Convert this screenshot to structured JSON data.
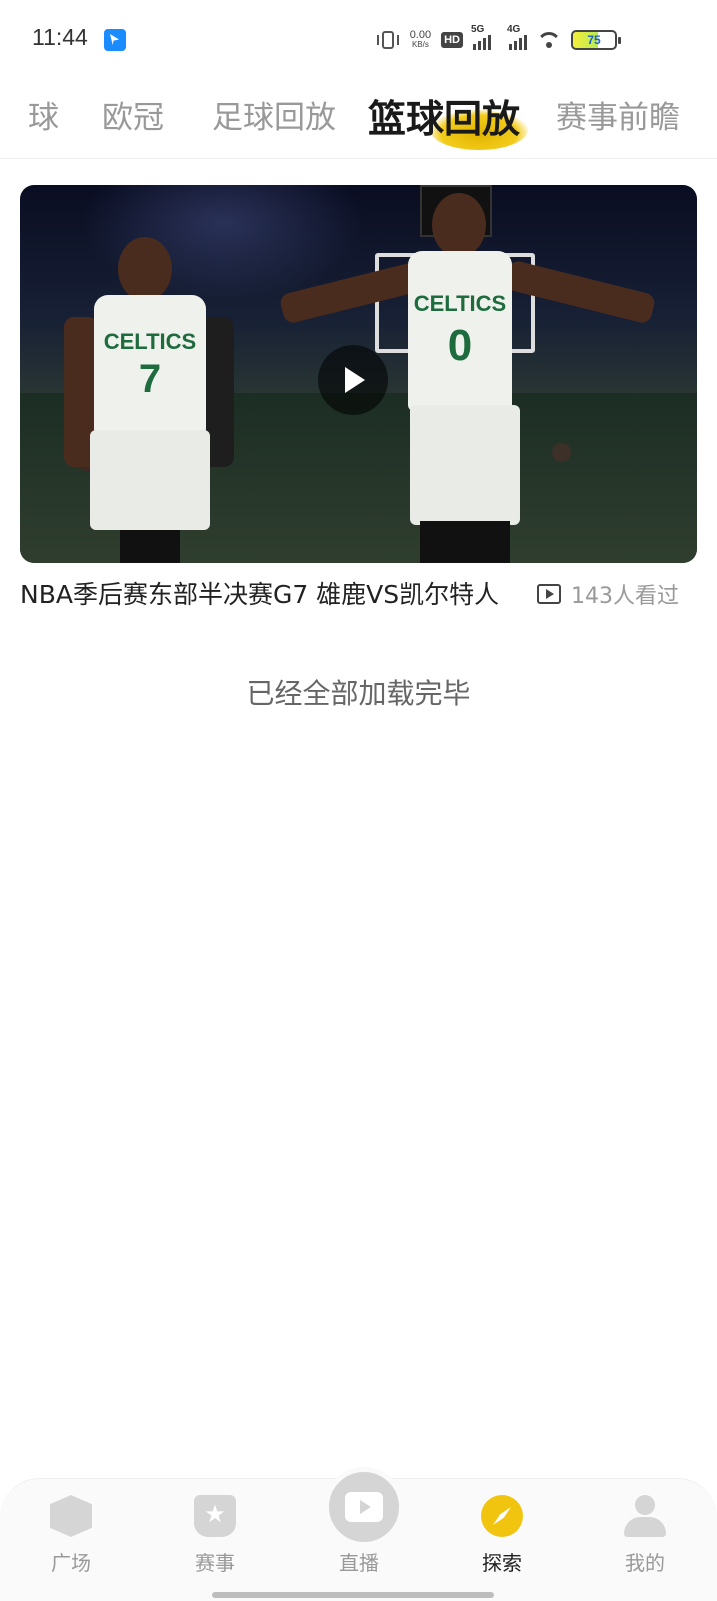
{
  "status_bar": {
    "time": "11:44",
    "net_speed_value": "0.00",
    "net_speed_unit": "KB/s",
    "hd_label": "HD",
    "signal1_label": "5G",
    "signal2_label": "4G",
    "battery_level": "75"
  },
  "tabs": [
    {
      "label": "球",
      "active": false
    },
    {
      "label": "欧冠",
      "active": false
    },
    {
      "label": "足球回放",
      "active": false
    },
    {
      "label": "篮球回放",
      "active": true
    },
    {
      "label": "赛事前瞻",
      "active": false
    }
  ],
  "video": {
    "title": "NBA季后赛东部半决赛G7 雄鹿VS凯尔特人",
    "views": "143人看过",
    "jersey_left_team": "CELTICS",
    "jersey_left_number": "7",
    "jersey_right_team": "CELTICS",
    "jersey_right_number": "0"
  },
  "end_message": "已经全部加载完毕",
  "bottom_nav": [
    {
      "label": "广场",
      "icon": "box-icon",
      "active": false
    },
    {
      "label": "赛事",
      "icon": "star-badge-icon",
      "active": false
    },
    {
      "label": "直播",
      "icon": "tv-play-icon",
      "active": false
    },
    {
      "label": "探索",
      "icon": "compass-icon",
      "active": true
    },
    {
      "label": "我的",
      "icon": "user-icon",
      "active": false
    }
  ],
  "colors": {
    "accent": "#f3cc1b",
    "active_text": "#1a1a1a",
    "inactive_text": "#999999"
  }
}
